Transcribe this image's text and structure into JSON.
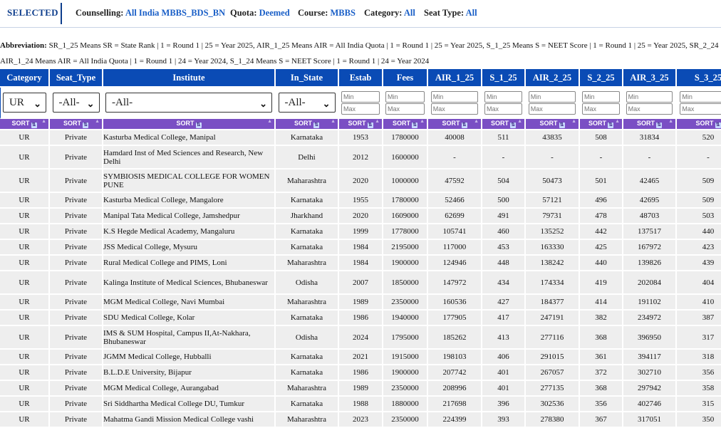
{
  "filters": {
    "selected_label": "SELECTED",
    "counselling_label": "Counselling:",
    "counselling_value": "All India MBBS_BDS_BN",
    "quota_label": "Quota:",
    "quota_value": "Deemed",
    "course_label": "Course:",
    "course_value": "MBBS",
    "category_label": "Category:",
    "category_value": "All",
    "seat_type_label": "Seat Type:",
    "seat_type_value": "All"
  },
  "abbreviation": {
    "label": "Abbreviation:",
    "line1": "SR_1_25 Means SR = State Rank | 1 = Round 1 | 25 = Year 2025, AIR_1_25 Means AIR = All India Quota | 1 = Round 1 | 25 = Year 2025, S_1_25 Means S = NEET Score | 1 = Round 1 | 25 = Year 2025, SR_2_24",
    "line2": "AIR_1_24 Means AIR = All India Quota | 1 = Round 1 | 24 = Year 2024, S_1_24 Means S = NEET Score | 1 = Round 1 | 24 = Year 2024"
  },
  "table": {
    "headers": [
      "Category",
      "Seat_Type",
      "Institute",
      "In_State",
      "Estab",
      "Fees",
      "AIR_1_25",
      "S_1_25",
      "AIR_2_25",
      "S_2_25",
      "AIR_3_25",
      "S_3_25"
    ],
    "filter_selects": {
      "category": "UR",
      "seat_type": "-All-",
      "institute": "-All-",
      "in_state": "-All-"
    },
    "min_placeholder": "Min",
    "max_placeholder": "Max",
    "sort_label": "SORT",
    "rows": [
      [
        "UR",
        "Private",
        "Kasturba Medical College, Manipal",
        "Karnataka",
        "1953",
        "1780000",
        "40008",
        "511",
        "43835",
        "508",
        "31834",
        "520"
      ],
      [
        "UR",
        "Private",
        "Hamdard Inst of Med Sciences and Research, New Delhi",
        "Delhi",
        "2012",
        "1600000",
        "-",
        "-",
        "-",
        "-",
        "-",
        "-"
      ],
      [
        "UR",
        "Private",
        "SYMBIOSIS MEDICAL COLLEGE FOR WOMEN PUNE",
        "Maharashtra",
        "2020",
        "1000000",
        "47592",
        "504",
        "50473",
        "501",
        "42465",
        "509"
      ],
      [
        "UR",
        "Private",
        "Kasturba Medical College, Mangalore",
        "Karnataka",
        "1955",
        "1780000",
        "52466",
        "500",
        "57121",
        "496",
        "42695",
        "509"
      ],
      [
        "UR",
        "Private",
        "Manipal Tata Medical College, Jamshedpur",
        "Jharkhand",
        "2020",
        "1609000",
        "62699",
        "491",
        "79731",
        "478",
        "48703",
        "503"
      ],
      [
        "UR",
        "Private",
        "K.S Hegde Medical Academy, Mangaluru",
        "Karnataka",
        "1999",
        "1778000",
        "105741",
        "460",
        "135252",
        "442",
        "137517",
        "440"
      ],
      [
        "UR",
        "Private",
        "JSS Medical College, Mysuru",
        "Karnataka",
        "1984",
        "2195000",
        "117000",
        "453",
        "163330",
        "425",
        "167972",
        "423"
      ],
      [
        "UR",
        "Private",
        "Rural Medical College and PIMS, Loni",
        "Maharashtra",
        "1984",
        "1900000",
        "124946",
        "448",
        "138242",
        "440",
        "139826",
        "439"
      ],
      [
        "UR",
        "Private",
        "Kalinga Institute of Medical Sciences, Bhubaneswar",
        "Odisha",
        "2007",
        "1850000",
        "147972",
        "434",
        "174334",
        "419",
        "202084",
        "404"
      ],
      [
        "UR",
        "Private",
        "MGM Medical College, Navi Mumbai",
        "Maharashtra",
        "1989",
        "2350000",
        "160536",
        "427",
        "184377",
        "414",
        "191102",
        "410"
      ],
      [
        "UR",
        "Private",
        "SDU Medical College, Kolar",
        "Karnataka",
        "1986",
        "1940000",
        "177905",
        "417",
        "247191",
        "382",
        "234972",
        "387"
      ],
      [
        "UR",
        "Private",
        "IMS & SUM Hospital, Campus II,At-Nakhara, Bhubaneswar",
        "Odisha",
        "2024",
        "1795000",
        "185262",
        "413",
        "277116",
        "368",
        "396950",
        "317"
      ],
      [
        "UR",
        "Private",
        "JGMM Medical College, Hubballi",
        "Karnataka",
        "2021",
        "1915000",
        "198103",
        "406",
        "291015",
        "361",
        "394117",
        "318"
      ],
      [
        "UR",
        "Private",
        "B.L.D.E University, Bijapur",
        "Karnataka",
        "1986",
        "1900000",
        "207742",
        "401",
        "267057",
        "372",
        "302710",
        "356"
      ],
      [
        "UR",
        "Private",
        "MGM Medical College, Aurangabad",
        "Maharashtra",
        "1989",
        "2350000",
        "208996",
        "401",
        "277135",
        "368",
        "297942",
        "358"
      ],
      [
        "UR",
        "Private",
        "Sri Siddhartha Medical College DU, Tumkur",
        "Karnataka",
        "1988",
        "1880000",
        "217698",
        "396",
        "302536",
        "356",
        "402746",
        "315"
      ],
      [
        "UR",
        "Private",
        "Mahatma Gandi Mission Medical College vashi",
        "Maharashtra",
        "2023",
        "2350000",
        "224399",
        "393",
        "278380",
        "367",
        "317051",
        "350"
      ]
    ]
  }
}
